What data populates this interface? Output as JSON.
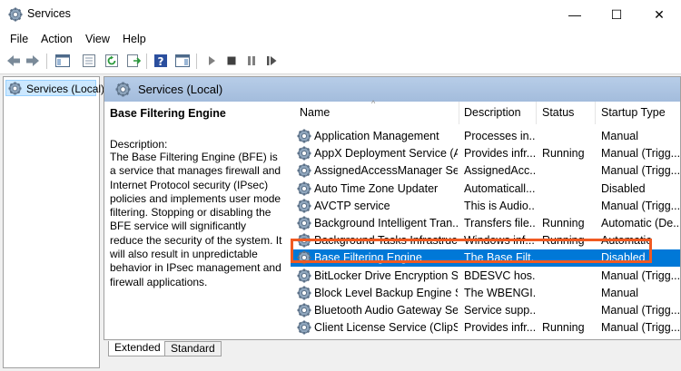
{
  "window": {
    "title": "Services",
    "minimize": "—",
    "maximize": "☐",
    "close": "✕"
  },
  "menu": {
    "file": "File",
    "action": "Action",
    "view": "View",
    "help": "Help"
  },
  "tree": {
    "root_label": "Services (Local)"
  },
  "panel": {
    "header_title": "Services (Local)",
    "selected_name": "Base Filtering Engine",
    "description_label": "Description:",
    "description_text": "The Base Filtering Engine (BFE) is a service that manages firewall and Internet Protocol security (IPsec) policies and implements user mode filtering. Stopping or disabling the BFE service will significantly reduce the security of the system. It will also result in unpredictable behavior in IPsec management and firewall applications."
  },
  "columns": {
    "name": "Name",
    "description": "Description",
    "status": "Status",
    "startup": "Startup Type"
  },
  "rows": [
    {
      "name": "Application Management",
      "description": "Processes in...",
      "status": "",
      "startup": "Manual"
    },
    {
      "name": "AppX Deployment Service (A...",
      "description": "Provides infr...",
      "status": "Running",
      "startup": "Manual (Trigg..."
    },
    {
      "name": "AssignedAccessManager Ser...",
      "description": "AssignedAcc...",
      "status": "",
      "startup": "Manual (Trigg..."
    },
    {
      "name": "Auto Time Zone Updater",
      "description": "Automaticall...",
      "status": "",
      "startup": "Disabled"
    },
    {
      "name": "AVCTP service",
      "description": "This is Audio...",
      "status": "",
      "startup": "Manual (Trigg..."
    },
    {
      "name": "Background Intelligent Tran...",
      "description": "Transfers file...",
      "status": "Running",
      "startup": "Automatic (De..."
    },
    {
      "name": "Background Tasks Infrastruc...",
      "description": "Windows inf...",
      "status": "Running",
      "startup": "Automatic"
    },
    {
      "name": "Base Filtering Engine",
      "description": "The Base Filt...",
      "status": "",
      "startup": "Disabled"
    },
    {
      "name": "BitLocker Drive Encryption S...",
      "description": "BDESVC hos...",
      "status": "",
      "startup": "Manual (Trigg..."
    },
    {
      "name": "Block Level Backup Engine S...",
      "description": "The WBENGI...",
      "status": "",
      "startup": "Manual"
    },
    {
      "name": "Bluetooth Audio Gateway Se...",
      "description": "Service supp...",
      "status": "",
      "startup": "Manual (Trigg..."
    },
    {
      "name": "Client License Service (ClipSV...",
      "description": "Provides infr...",
      "status": "Running",
      "startup": "Manual (Trigg..."
    }
  ],
  "tabs": {
    "extended": "Extended",
    "standard": "Standard"
  },
  "colors": {
    "selection": "#0078d7",
    "highlight_outline": "#f05a22",
    "header_band": "#b7cde8"
  },
  "toolbar_icons": [
    "back-arrow-icon",
    "forward-arrow-icon",
    "show-hide-tree-icon",
    "properties-icon",
    "refresh-icon",
    "export-list-icon",
    "help-icon",
    "action-pane-icon",
    "start-service-icon",
    "stop-service-icon",
    "pause-service-icon",
    "restart-service-icon"
  ]
}
